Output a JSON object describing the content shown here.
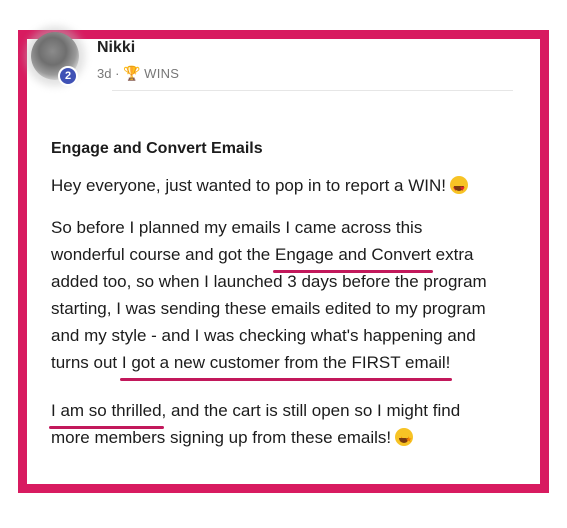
{
  "post": {
    "author": "Nikki",
    "level": "2",
    "time": "3d",
    "separator": "·",
    "category": "WINS",
    "title": "Engage and Convert Emails",
    "greeting": "Hey everyone, just wanted to pop in to report a WIN!",
    "p2": {
      "l1": "So before I planned my emails I came across this",
      "l2a": "wonderful course and got the ",
      "l2u": "Engage and Convert",
      "l2b": " extra",
      "l3": "added too, so when I launched 3 days before the program",
      "l4": "starting, I was sending these emails edited to my program",
      "l5": "and my style - and I was checking what's happening and",
      "l6a": "turns out ",
      "l6u": "I got a new customer from the FIRST email!"
    },
    "p3": {
      "l1u": "I am so thrilled",
      "l1b": ", and the cart is still open so I might find",
      "l2": "more members signing up from these emails!"
    }
  },
  "icons": {
    "trophy": "trophy-icon",
    "emoji_heart_eyes": "heart-eyes-emoji-icon",
    "emoji_star_struck": "star-struck-emoji-icon"
  },
  "colors": {
    "frame": "#d81b60",
    "underline": "#c2185b",
    "badge": "#3f51b5"
  }
}
